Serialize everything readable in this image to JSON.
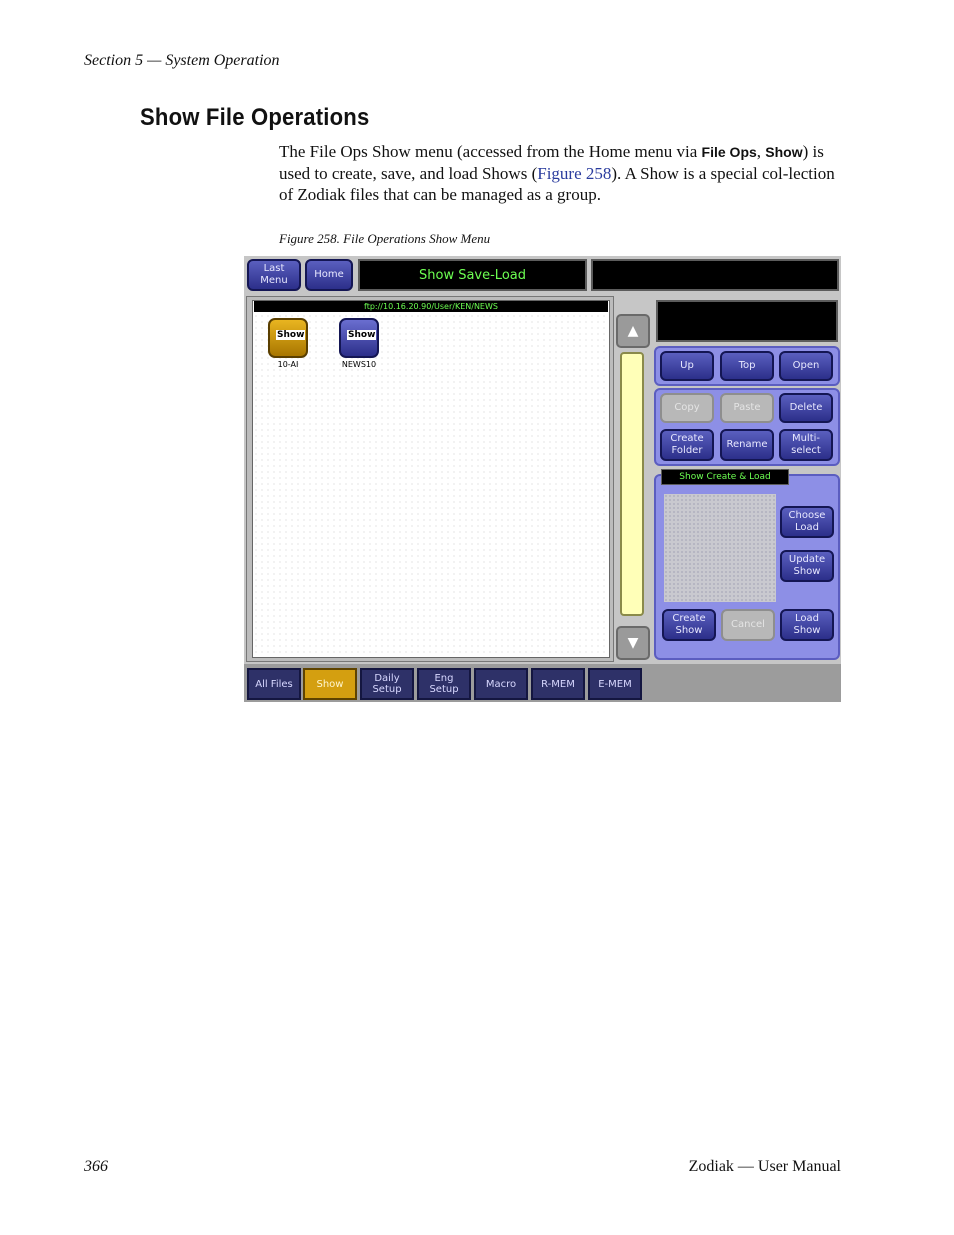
{
  "header": {
    "section": "Section 5 — System Operation"
  },
  "page": {
    "title": "Show File Operations",
    "body": {
      "t1": "The File Ops Show menu (accessed from the Home menu via ",
      "ui1": "File Ops",
      "t2": ", ",
      "ui2": "Show",
      "t3": ") is used to create, save, and load Shows (",
      "link": "Figure 258",
      "t4": "). A Show is a special col-lection of Zodiak files that can be managed as a group."
    },
    "caption": "Figure 258.  File Operations Show Menu"
  },
  "screenshot": {
    "top_buttons": {
      "last_menu": "Last\nMenu",
      "home": "Home"
    },
    "menu_title": "Show Save-Load",
    "path": "ftp://10.16.20.90/User/KEN/NEWS",
    "files": [
      {
        "icon_label": "Show",
        "name": "10-AI",
        "selected": true
      },
      {
        "icon_label": "Show",
        "name": "NEWS10",
        "selected": false
      }
    ],
    "nav_buttons": {
      "up": "Up",
      "top": "Top",
      "open": "Open"
    },
    "edit_buttons": {
      "copy": "Copy",
      "paste": "Paste",
      "delete": "Delete",
      "create_folder": "Create\nFolder",
      "rename": "Rename",
      "multi_select": "Multi-\nselect"
    },
    "show_panel": {
      "title": "Show Create & Load",
      "choose_load": "Choose\nLoad",
      "update_show": "Update\nShow",
      "create_show": "Create\nShow",
      "cancel": "Cancel",
      "load_show": "Load\nShow"
    },
    "tabs": [
      "All Files",
      "Show",
      "Daily\nSetup",
      "Eng\nSetup",
      "Macro",
      "R-MEM",
      "E-MEM"
    ],
    "selected_tab": "Show"
  },
  "footer": {
    "page_number": "366",
    "manual": "Zodiak — User Manual"
  }
}
